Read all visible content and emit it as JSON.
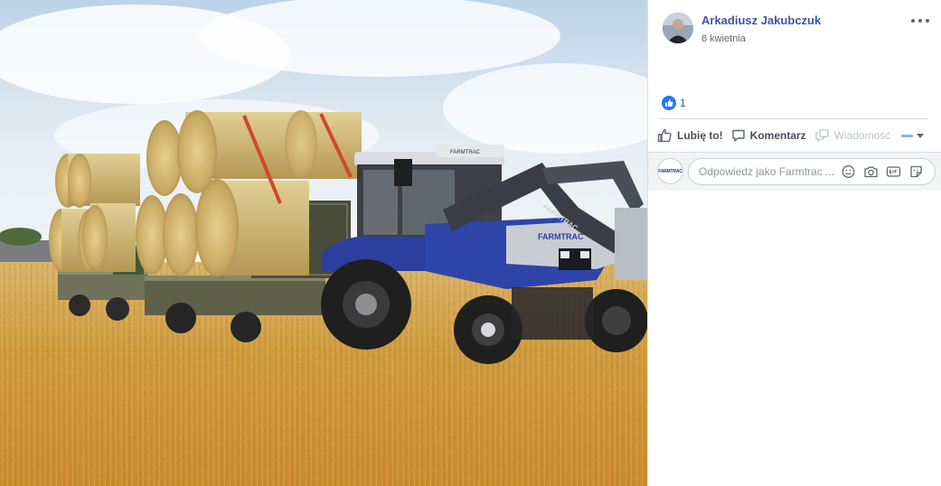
{
  "post": {
    "author": "Arkadiusz Jakubczuk",
    "date": "8 kwietnia",
    "likes_count": "1"
  },
  "actions": {
    "like": "Lubię to!",
    "comment": "Komentarz",
    "message": "Wiadomość"
  },
  "reply": {
    "placeholder": "Odpowiedz jako Farmtrac ...",
    "page_logo": "FARMTRAC"
  },
  "photo": {
    "brand_hood": "FARMTRAC",
    "brand_loader": "FARMTRAC",
    "brand_cab": "FARMTRAC"
  },
  "colors": {
    "link": "#385898",
    "accent": "#2078f4",
    "tractor_blue": "#2c3f9e"
  },
  "icons": [
    "more-options-icon",
    "like-reaction-icon",
    "thumbs-up-icon",
    "comment-icon",
    "message-icon",
    "emoji-icon",
    "camera-icon",
    "gif-icon",
    "sticker-icon"
  ]
}
